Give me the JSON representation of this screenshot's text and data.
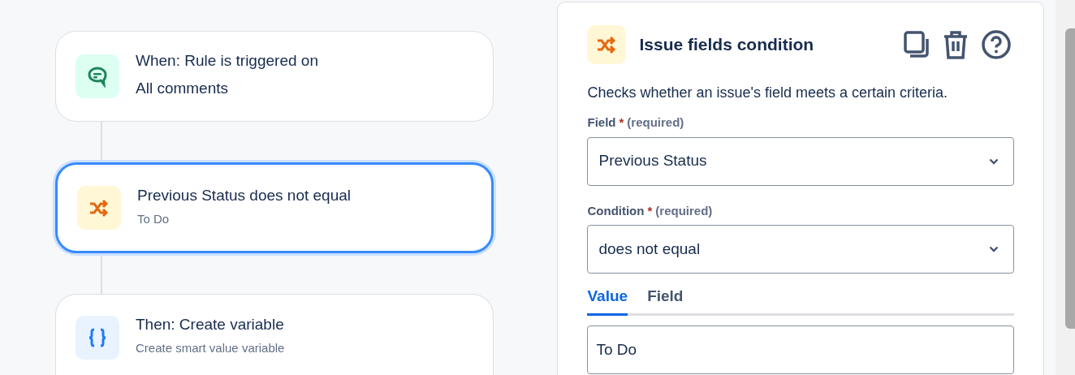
{
  "steps": [
    {
      "kind": "trigger",
      "title": "When: Rule is triggered on",
      "subtitle": "All comments",
      "selected": false
    },
    {
      "kind": "condition",
      "title": "Previous Status does not equal",
      "subtitle": "To Do",
      "selected": true
    },
    {
      "kind": "action",
      "title": "Then: Create variable",
      "subtitle": "Create smart value variable",
      "selected": false
    }
  ],
  "panel": {
    "title": "Issue fields condition",
    "description": "Checks whether an issue's field meets a certain criteria.",
    "fields": [
      {
        "label": "Field",
        "required_mark": "*",
        "required_text": "(required)",
        "value": "Previous Status"
      },
      {
        "label": "Condition",
        "required_mark": "*",
        "required_text": "(required)",
        "value": "does not equal"
      }
    ],
    "tabs": [
      {
        "label": "Value",
        "selected": true
      },
      {
        "label": "Field",
        "selected": false
      }
    ],
    "value_input": {
      "value": "To Do"
    }
  }
}
